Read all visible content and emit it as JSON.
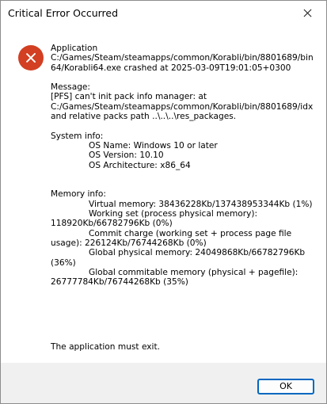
{
  "window": {
    "title": "Critical Error Occurred"
  },
  "icons": {
    "close": "close-icon",
    "error": "error-icon"
  },
  "colors": {
    "error_red": "#d23f22",
    "button_border": "#0067c0"
  },
  "content": {
    "application_heading": "Application",
    "application_lines": [
      "C:/Games/Steam/steamapps/common/Korabli/bin/8801689/bin",
      "64/Korabli64.exe crashed at 2025-03-09T19:01:05+0300"
    ],
    "message_heading": "Message:",
    "message_lines": [
      "[PFS] can't init pack info manager: at",
      "C:/Games/Steam/steamapps/common/Korabli/bin/8801689/idx",
      "and relative packs path ..\\..\\..\\res_packages."
    ],
    "system_heading": "System info:",
    "system_lines": [
      "OS Name: Windows 10 or later",
      "OS Version: 10.10",
      "OS Architecture: x86_64"
    ],
    "memory_heading": "Memory info:",
    "memory_lines": [
      "Virtual memory: 38436228Kb/137438953344Kb (1%)",
      "Working set (process physical memory):",
      "118920Kb/66782796Kb (0%)",
      "Commit charge (working set + process page file",
      "usage): 226124Kb/76744268Kb (0%)",
      "Global physical memory: 24049868Kb/66782796Kb",
      "(36%)",
      "Global commitable memory (physical + pagefile):",
      "26777784Kb/76744268Kb (35%)"
    ],
    "exit_text": "The application must exit."
  },
  "footer": {
    "ok_label": "OK"
  }
}
